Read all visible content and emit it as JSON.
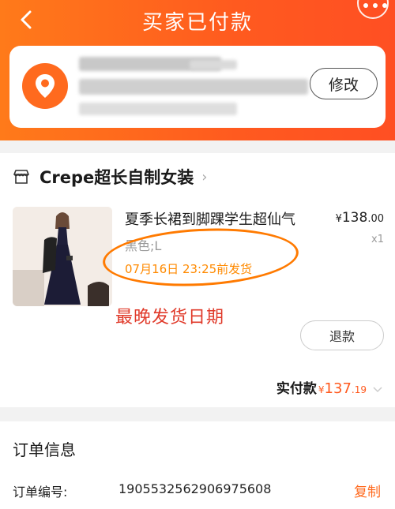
{
  "header": {
    "title": "买家已付款",
    "back_icon": "chevron-left-icon",
    "more_icon": "more-dots-icon",
    "background_color": "#ff5a1f"
  },
  "address": {
    "location_icon": "location-pin-icon",
    "recipient_blurred": true,
    "edit_label": "修改"
  },
  "shop": {
    "icon": "store-icon",
    "name": "Crepe超长自制女装",
    "chevron": "›"
  },
  "item": {
    "title": "夏季长裙到脚踝学生超仙气",
    "price_symbol": "¥",
    "price_int": "138",
    "price_dec": ".00",
    "sku": "黑色;L",
    "quantity": "x1",
    "ship_deadline": "07月16日 23:25前发货",
    "refund_label": "退款"
  },
  "annotation": {
    "text": "最晚发货日期",
    "color": "#e03a2a"
  },
  "payment": {
    "label": "实付款",
    "symbol": "¥",
    "amount_int": "137",
    "amount_dec": ".19"
  },
  "order": {
    "section_title": "订单信息",
    "number_label": "订单编号:",
    "number_value": "1905532562906975608",
    "copy_label": "复制"
  }
}
